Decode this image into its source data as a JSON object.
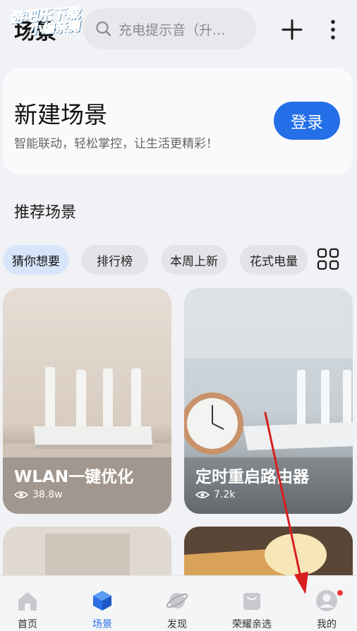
{
  "header": {
    "title": "场景",
    "watermark_line1": "游吧乐下载",
    "watermark_line2": "小编亲测",
    "search_placeholder": "充电提示音（升..."
  },
  "new_scene": {
    "title": "新建场景",
    "subtitle": "智能联动，轻松掌控，让生活更精彩！",
    "login_label": "登录"
  },
  "recommended": {
    "title": "推荐场景",
    "chips": [
      "猜你想要",
      "排行榜",
      "本周上新",
      "花式电量"
    ]
  },
  "cards": [
    {
      "name": "WLAN一键优化",
      "views": "38.8w"
    },
    {
      "name": "定时重启路由器",
      "views": "7.2k"
    }
  ],
  "bottom_nav": {
    "items": [
      "首页",
      "场景",
      "发现",
      "荣耀亲选",
      "我的"
    ]
  },
  "colors": {
    "accent": "#256fe8",
    "chip_active": "#d6e5fa",
    "badge": "#f23a3a",
    "arrow": "#d81e1e"
  }
}
